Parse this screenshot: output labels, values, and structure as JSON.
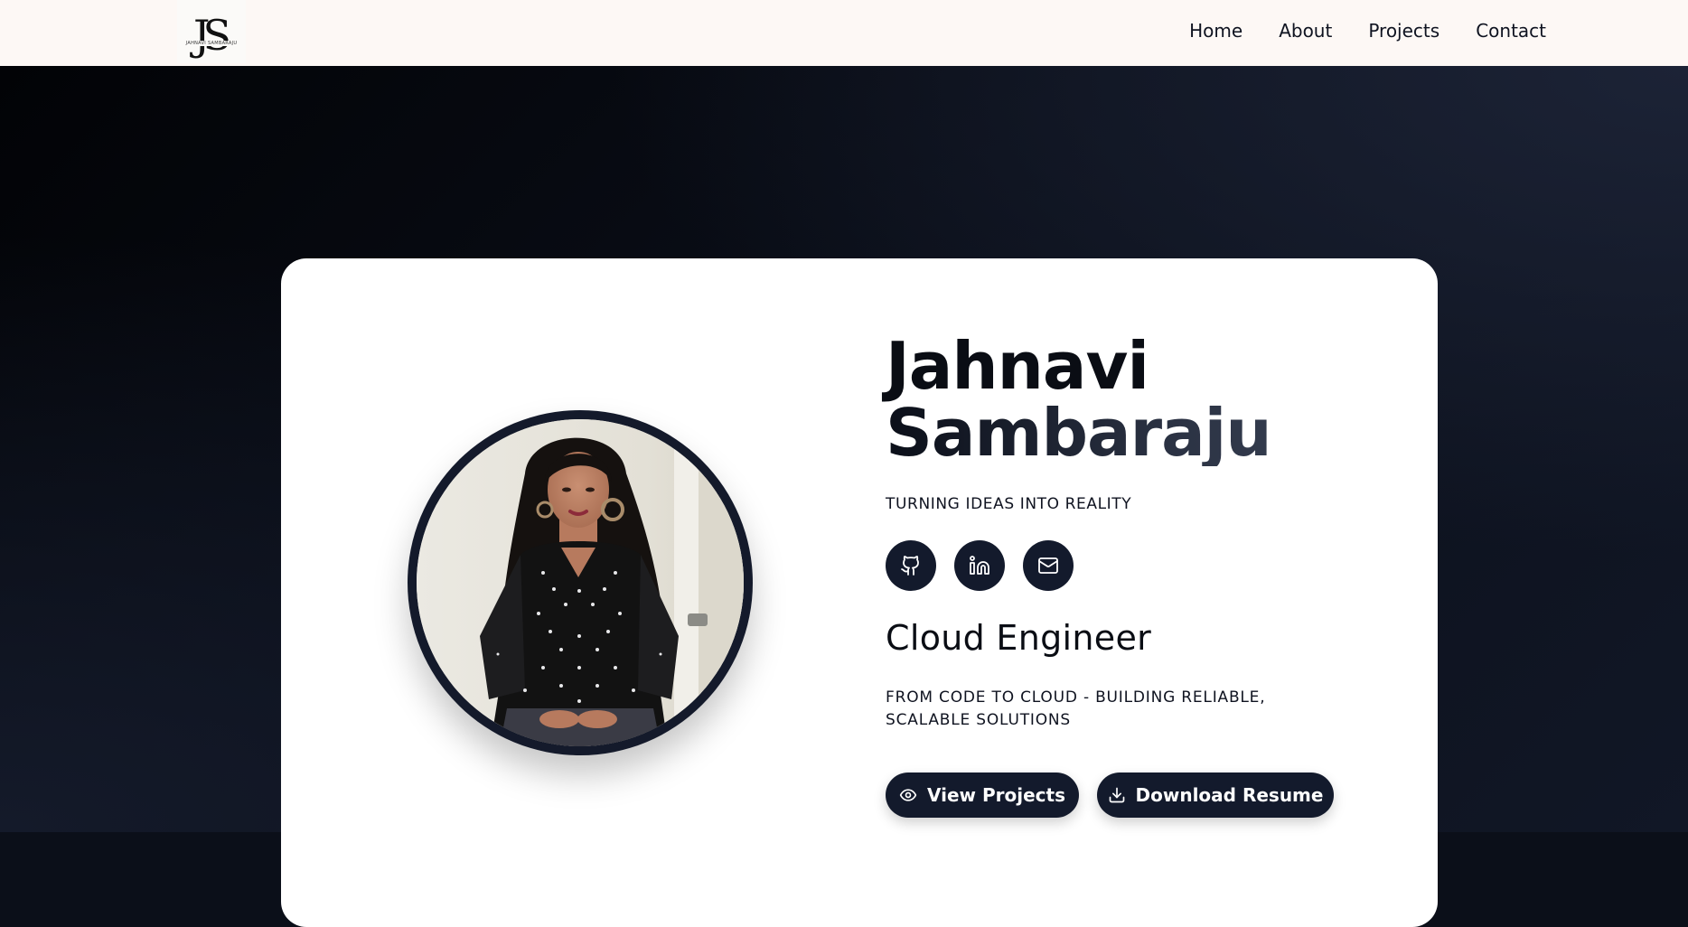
{
  "header": {
    "logo": {
      "monogram": "JS",
      "text": "JAHNAVI SAMBARAJU"
    },
    "nav": [
      {
        "label": "Home"
      },
      {
        "label": "About"
      },
      {
        "label": "Projects"
      },
      {
        "label": "Contact"
      }
    ]
  },
  "hero": {
    "name_line1": "Jahnavi",
    "name_line2": "Sambaraju",
    "tagline": "TURNING IDEAS INTO REALITY",
    "socials": [
      {
        "icon": "github-icon"
      },
      {
        "icon": "linkedin-icon"
      },
      {
        "icon": "mail-icon"
      }
    ],
    "role": "Cloud Engineer",
    "description": "FROM CODE TO CLOUD - BUILDING RELIABLE, SCALABLE SOLUTIONS",
    "buttons": {
      "view_projects": "View Projects",
      "download_resume": "Download Resume"
    }
  },
  "colors": {
    "header_bg": "#fdf8f5",
    "hero_bg": "#0b0f19",
    "card_bg": "#ffffff",
    "accent_dark": "#131a2c"
  }
}
